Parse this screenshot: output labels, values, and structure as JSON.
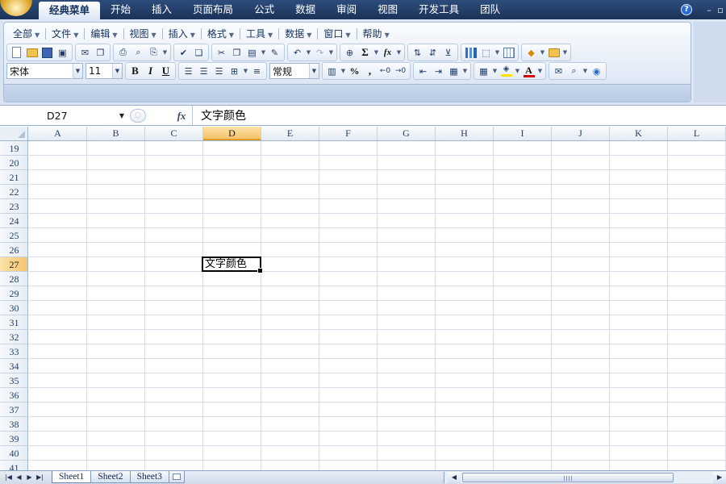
{
  "ribbon_tabs": [
    "经典菜单",
    "开始",
    "插入",
    "页面布局",
    "公式",
    "数据",
    "审阅",
    "视图",
    "开发工具",
    "团队"
  ],
  "active_tab": "经典菜单",
  "window_controls": {
    "help": "?",
    "minimize": "–",
    "restore": "▫"
  },
  "classic_menu": [
    "全部",
    "文件",
    "编辑",
    "视图",
    "插入",
    "格式",
    "工具",
    "数据",
    "窗口",
    "帮助"
  ],
  "toolbar": {
    "font_name": "宋体",
    "font_size": "11",
    "bold": "B",
    "italic": "I",
    "underline": "U",
    "number_format": "常规",
    "percent": "%",
    "comma": ",",
    "sum": "Σ",
    "fx": "fx",
    "font_color_letter": "A",
    "font_color": "#d80000",
    "fill_color": "#ffe100"
  },
  "formula_bar": {
    "name_box": "D27",
    "fx_label": "fx",
    "value": "文字颜色"
  },
  "grid": {
    "columns": [
      "A",
      "B",
      "C",
      "D",
      "E",
      "F",
      "G",
      "H",
      "I",
      "J",
      "K",
      "L"
    ],
    "rows": [
      "19",
      "20",
      "21",
      "22",
      "23",
      "24",
      "25",
      "26",
      "27",
      "28",
      "29",
      "30",
      "31",
      "32",
      "33",
      "34",
      "35",
      "36",
      "37",
      "38",
      "39",
      "40",
      "41"
    ],
    "selected_column": "D",
    "selected_row": "27",
    "active_cell_text": "文字颜色"
  },
  "sheets": [
    "Sheet1",
    "Sheet2",
    "Sheet3"
  ],
  "active_sheet": "Sheet1"
}
